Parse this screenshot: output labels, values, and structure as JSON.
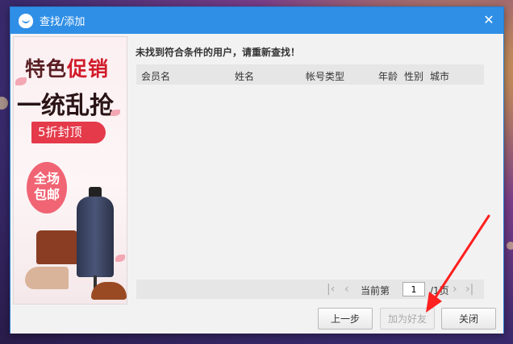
{
  "window": {
    "title": "查找/添加",
    "close_glyph": "✕"
  },
  "ad": {
    "line1_part1": "特色",
    "line1_part2": "促销",
    "line2": "一统乱抢",
    "banner": "5折封顶",
    "circle_line1": "全场",
    "circle_line2": "包邮"
  },
  "content": {
    "message": "未找到符合条件的用户，请重新查找！",
    "columns": [
      "会员名",
      "姓名",
      "帐号类型",
      "年龄",
      "性别",
      "城市"
    ],
    "rows": []
  },
  "pager": {
    "prefix": "当前第",
    "current_page": "1",
    "suffix": "/1页"
  },
  "footer": {
    "prev_label": "上一步",
    "add_friend_label": "加为好友",
    "close_label": "关闭"
  },
  "colors": {
    "titlebar": "#2f8fe6",
    "annotation_arrow": "#ff2020"
  }
}
